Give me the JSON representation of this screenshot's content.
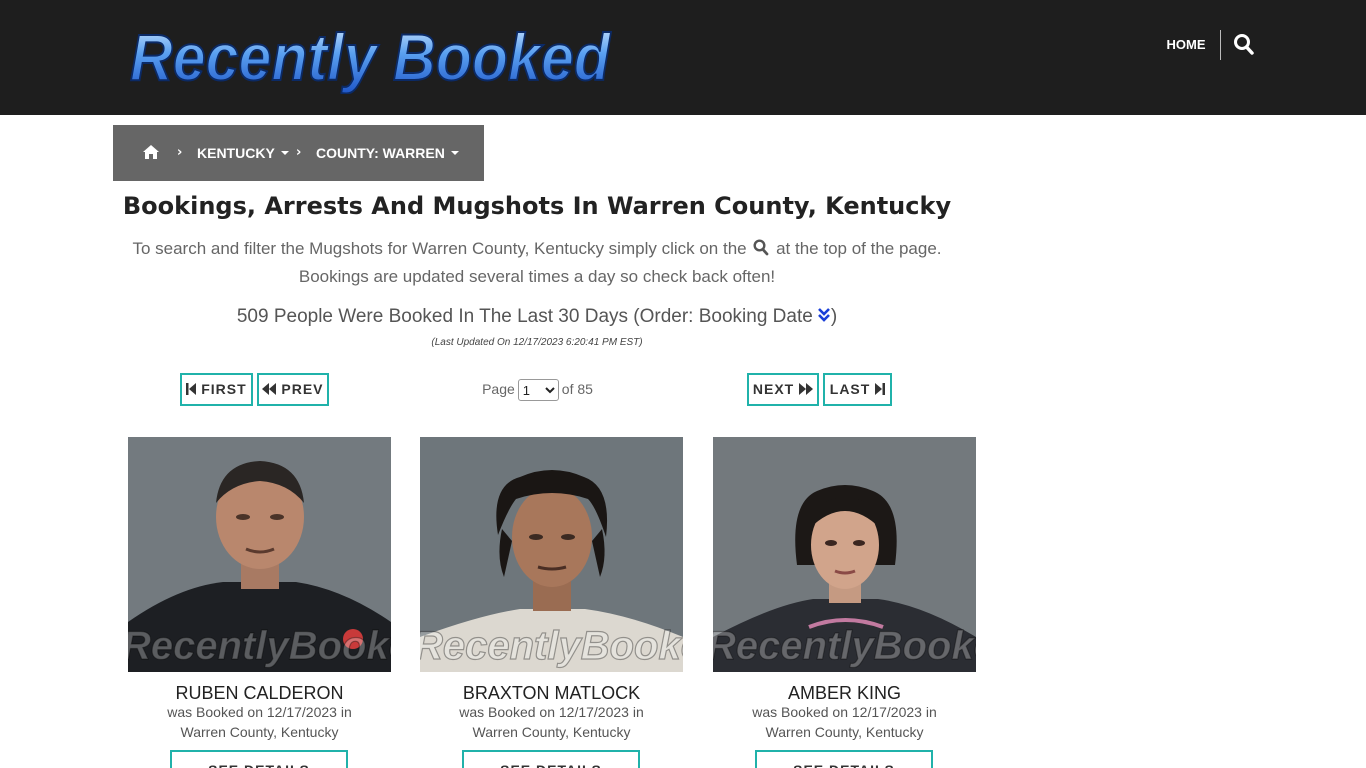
{
  "header": {
    "logo_text": "Recently Booked",
    "nav_home": "HOME",
    "search_icon": "search-icon"
  },
  "breadcrumb": {
    "home_icon": "home-icon",
    "state": "KENTUCKY",
    "county": "COUNTY: WARREN"
  },
  "main": {
    "title": "Bookings, Arrests And Mugshots In Warren County, Kentucky",
    "intro_before": "To search and filter the Mugshots for Warren County, Kentucky simply click on the",
    "intro_after": "at the top of the page.",
    "intro_line2": "Bookings are updated several times a day so check back often!",
    "count_text": "509 People Were Booked In The Last 30 Days (Order: Booking Date",
    "count_close": ")",
    "updated": "(Last Updated On 12/17/2023 6:20:41 PM EST)"
  },
  "pager": {
    "first": "FIRST",
    "prev": "PREV",
    "page_label": "Page",
    "current_page": "1",
    "of_label": "of 85",
    "next": "NEXT",
    "last": "LAST"
  },
  "watermark": "RecentlyBooked.com",
  "cards": [
    {
      "name": "RUBEN CALDERON",
      "line1": "was Booked on 12/17/2023 in",
      "line2": "Warren County, Kentucky",
      "button": "SEE DETAILS"
    },
    {
      "name": "BRAXTON MATLOCK",
      "line1": "was Booked on 12/17/2023 in",
      "line2": "Warren County, Kentucky",
      "button": "SEE DETAILS"
    },
    {
      "name": "AMBER KING",
      "line1": "was Booked on 12/17/2023 in",
      "line2": "Warren County, Kentucky",
      "button": "SEE DETAILS"
    }
  ],
  "colors": {
    "header_bg": "#1e1e1e",
    "breadcrumb_bg": "#666666",
    "accent": "#20b2aa",
    "logo_blue": "#3a7be0"
  }
}
